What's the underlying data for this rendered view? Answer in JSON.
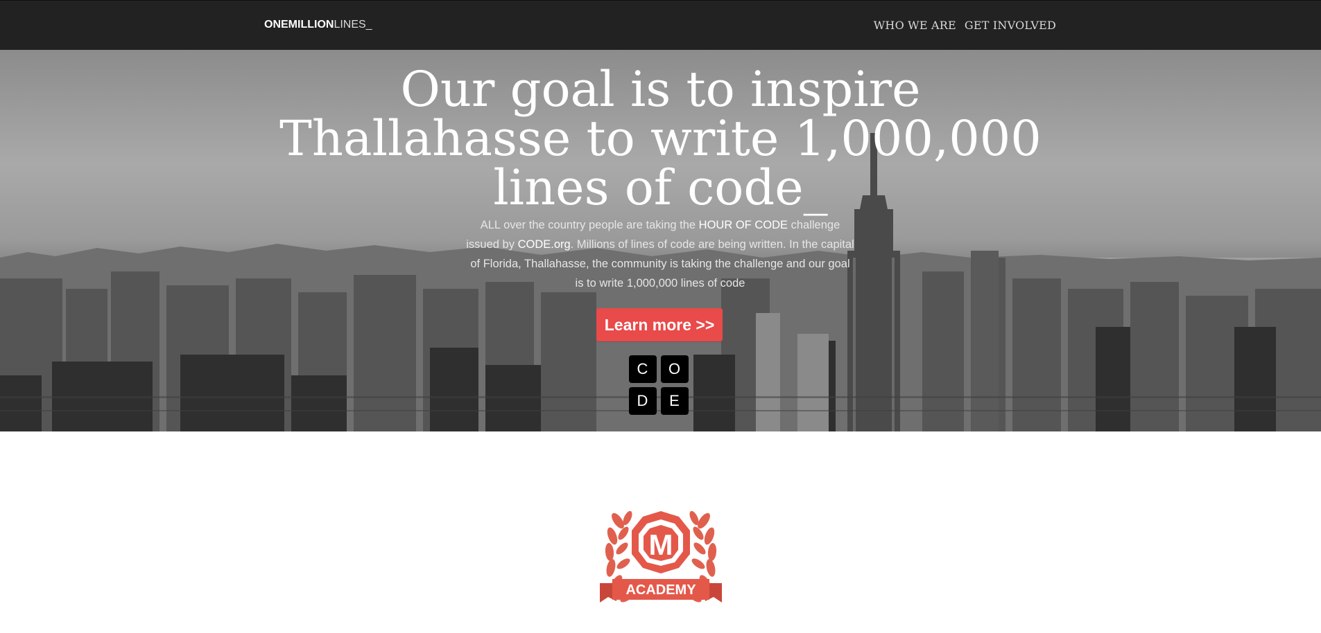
{
  "nav": {
    "brand_bold": "ONEMILLION",
    "brand_thin": "LINES_",
    "links": [
      "WHO WE ARE",
      "GET INVOLVED"
    ]
  },
  "hero": {
    "headline_lines": [
      "Our goal is to inspire",
      "Thallahasse to write 1,000,000",
      "lines of code_"
    ],
    "intro_part1": "ALL over the country people are taking the ",
    "intro_highlight1": "HOUR OF CODE",
    "intro_part2": " challenge issued by ",
    "intro_highlight2": "CODE.org",
    "intro_part3": ". Millions of lines of code are being written. In the capital of Florida, Thallahasse, the community is taking the challenge and our goal is to write 1,000,000 lines of code",
    "cta_label": "Learn more >>",
    "code_letters": [
      "C",
      "O",
      "D",
      "E"
    ]
  },
  "logo": {
    "letter": "M",
    "banner": "ACADEMY"
  },
  "colors": {
    "navbar_bg": "#222222",
    "accent_red": "#e94a4a",
    "logo_red": "#e55a4a"
  }
}
